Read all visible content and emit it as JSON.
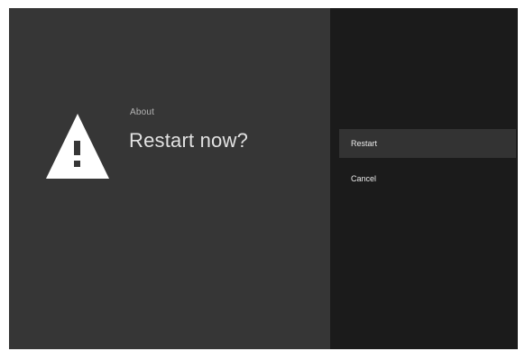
{
  "dialog": {
    "icon": "warning-triangle-icon",
    "subtitle": "About",
    "title": "Restart now?"
  },
  "actions": [
    {
      "label": "Restart",
      "selected": true
    },
    {
      "label": "Cancel",
      "selected": false
    }
  ],
  "colors": {
    "left_panel_bg": "#363636",
    "right_panel_bg": "#1b1b1b",
    "selected_item_bg": "#333333",
    "icon_fill": "#ffffff"
  }
}
